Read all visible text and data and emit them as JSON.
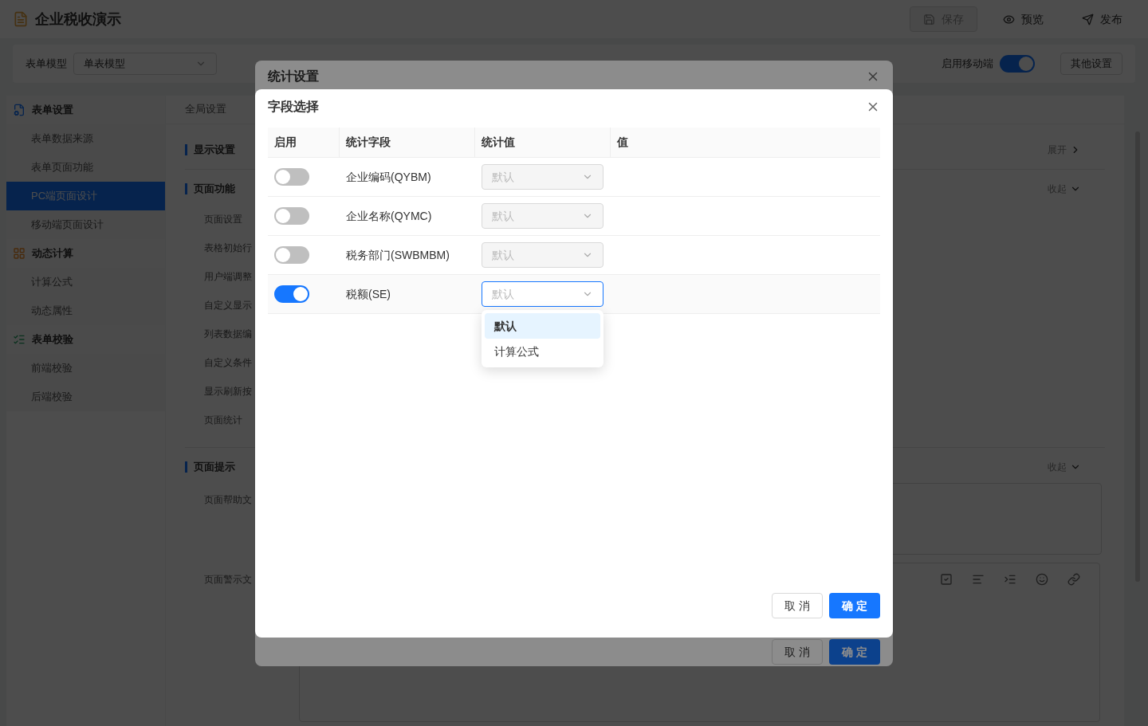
{
  "app": {
    "title": "企业税收演示",
    "actions": [
      {
        "kind": "save",
        "label": "保存",
        "disabled": true
      },
      {
        "kind": "preview",
        "label": "预览",
        "disabled": false
      },
      {
        "kind": "publish",
        "label": "发布",
        "disabled": false
      }
    ]
  },
  "toolbar": {
    "model_label": "表单模型",
    "model_value": "单表模型",
    "mobile_label": "启用移动端",
    "mobile_on": true,
    "other_button": "其他设置"
  },
  "sidebar": [
    {
      "title": "表单设置",
      "items": [
        {
          "label": "表单数据来源",
          "selected": false
        },
        {
          "label": "表单页面功能",
          "selected": false
        },
        {
          "label": "PC端页面设计",
          "selected": true
        },
        {
          "label": "移动端页面设计",
          "selected": false
        }
      ]
    },
    {
      "title": "动态计算",
      "items": [
        {
          "label": "计算公式",
          "selected": false
        },
        {
          "label": "动态属性",
          "selected": false
        }
      ]
    },
    {
      "title": "表单校验",
      "items": [
        {
          "label": "前端校验",
          "selected": false
        },
        {
          "label": "后端校验",
          "selected": false
        }
      ]
    }
  ],
  "tabs": [
    {
      "label": "全局设置",
      "selected": false
    }
  ],
  "sections": [
    {
      "title": "显示设置",
      "toggle": "展开",
      "expanded": false
    },
    {
      "title": "页面功能",
      "toggle": "收起",
      "expanded": true,
      "items": [
        "页面设置",
        "表格初始行",
        "用户端调整",
        "自定义显示",
        "列表数据编",
        "自定义条件",
        "显示刷新按",
        "页面统计"
      ]
    },
    {
      "title": "页面提示",
      "toggle": "收起",
      "expanded": true,
      "items": [
        "页面帮助文",
        "页面警示文"
      ]
    }
  ],
  "outer_dialog": {
    "title": "统计设置",
    "cancel": "取 消",
    "ok": "确 定"
  },
  "dialog": {
    "title": "字段选择",
    "columns": [
      "启用",
      "统计字段",
      "统计值",
      "值"
    ],
    "rows": [
      {
        "enabled": false,
        "field": "企业编码(QYBM)",
        "value": "默认",
        "open": false
      },
      {
        "enabled": false,
        "field": "企业名称(QYMC)",
        "value": "默认",
        "open": false
      },
      {
        "enabled": false,
        "field": "税务部门(SWBMBM)",
        "value": "默认",
        "open": false
      },
      {
        "enabled": true,
        "field": "税额(SE)",
        "value": "默认",
        "open": true
      }
    ],
    "options": [
      {
        "label": "默认",
        "selected": true
      },
      {
        "label": "计算公式",
        "selected": false
      }
    ],
    "cancel": "取 消",
    "ok": "确 定"
  }
}
